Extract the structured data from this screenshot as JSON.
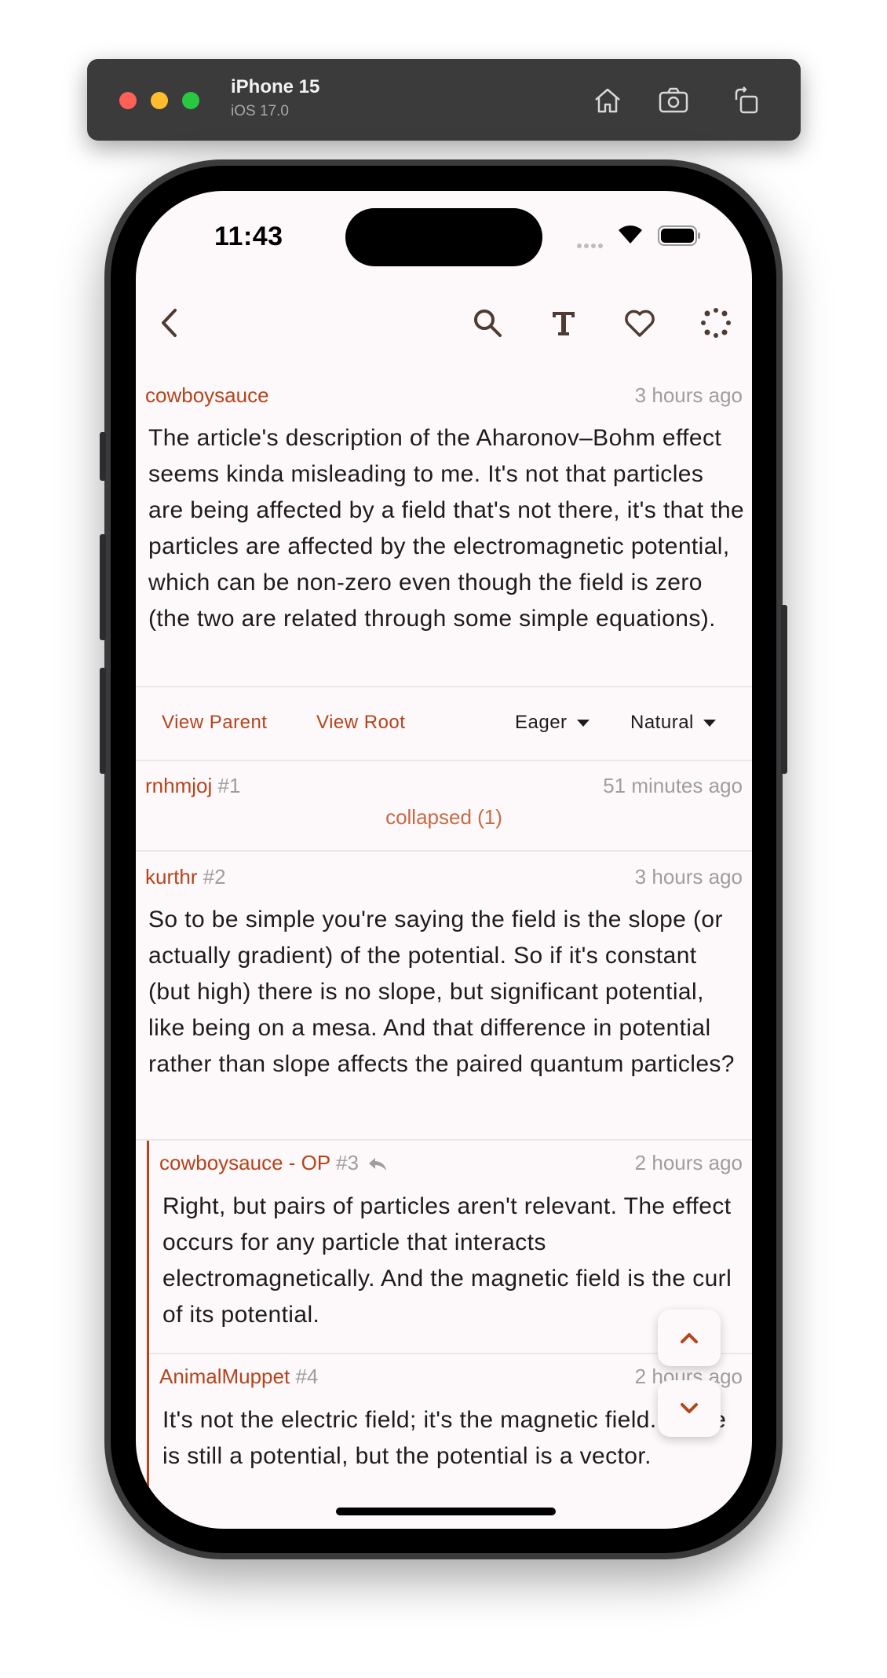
{
  "simulator": {
    "device_name": "iPhone 15",
    "os_version": "iOS 17.0",
    "buttons": [
      "home-icon",
      "screenshot-icon",
      "rotate-icon"
    ]
  },
  "status_bar": {
    "time": "11:43"
  },
  "app_bar": {
    "icons": [
      "back-arrow-icon",
      "search-icon",
      "text-size-icon",
      "favorite-heart-icon",
      "loading-spinner-icon"
    ]
  },
  "root_comment": {
    "author": "cowboysauce",
    "timestamp": "3 hours ago",
    "body": "The article's description of the Aharonov–Bohm effect seems kinda misleading to me. It's not that particles are being affected by a field that's not there, it's that the particles are affected by the electromagnetic potential, which can be non-zero even though the field is zero (the two are related through some simple equations)."
  },
  "actions": {
    "view_parent": "View Parent",
    "view_root": "View Root",
    "sort_mode": "Eager",
    "order_mode": "Natural"
  },
  "replies": [
    {
      "author": "rnhmjoj",
      "index": "#1",
      "timestamp": "51 minutes ago",
      "collapsed_label": "collapsed (1)"
    },
    {
      "author": "kurthr",
      "index": "#2",
      "timestamp": "3 hours ago",
      "body": "So to be simple you're saying the field is the slope (or actually gradient) of the potential. So if it's constant (but high) there is no slope, but significant potential, like being on a mesa. And that difference in potential rather than slope affects the paired quantum particles?"
    },
    {
      "author": "cowboysauce - OP",
      "index": "#3",
      "timestamp": "2 hours ago",
      "body": "Right, but pairs of particles aren't relevant. The effect occurs for any particle that interacts electromagnetically. And the magnetic field is the curl of its potential."
    },
    {
      "author": "AnimalMuppet",
      "index": "#4",
      "timestamp": "2 hours ago",
      "body": "It's not the electric field; it's the magnetic field. There is still a potential, but the potential is a vector."
    }
  ],
  "colors": {
    "accent": "#b5441b",
    "background": "#fdf8fa",
    "muted": "#9e9e9e"
  }
}
